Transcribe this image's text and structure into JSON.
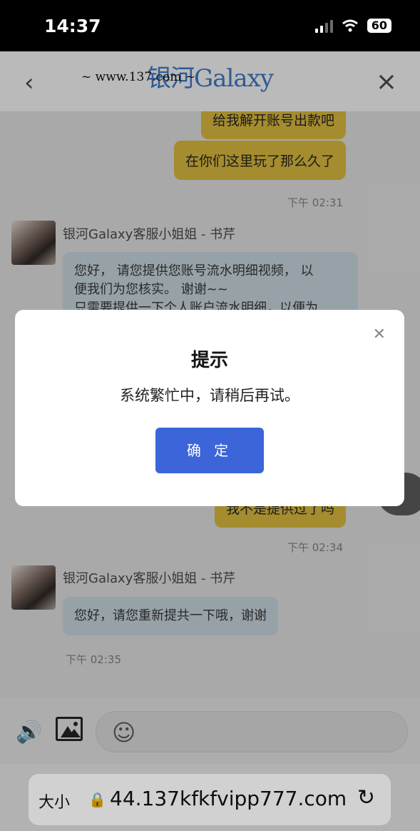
{
  "status_bar": {
    "time": "14:37",
    "battery": "60"
  },
  "header": {
    "logo_name": "银河Galaxy",
    "logo_url": "~ www.137.com ~",
    "back_icon": "chevron-left-icon",
    "close_icon": "close-icon"
  },
  "chat": {
    "messages": [
      {
        "text": "给我解开账号出款吧"
      },
      {
        "text": "在你们这里玩了那么久了"
      },
      {
        "time": "下午 02:31"
      },
      {
        "sender": "银河Galaxy客服小姐姐 - 书芹",
        "line1": "您好， 请您提供您账号流水明细视频， 以",
        "line2": "便我们为您核实。 谢谢~~",
        "line3": "只需要提供一下个人账户流水明细，以便为"
      },
      {
        "text": "我不是提供过了吗"
      },
      {
        "time": "下午 02:34"
      },
      {
        "sender": "银河Galaxy客服小姐姐 - 书芹",
        "text": "您好，请您重新提共一下哦，谢谢"
      },
      {
        "time": "下午 02:35"
      }
    ]
  },
  "input_bar": {
    "speaker_icon": "speaker-icon",
    "image_icon": "image-icon",
    "emoji_icon": "emoji-icon",
    "placeholder": ""
  },
  "url_bar": {
    "text_size": "大小",
    "url": "44.137kfkfvipp777.com"
  },
  "modal": {
    "title": "提示",
    "message": "系统繁忙中，请稍后再试。",
    "confirm": "确 定"
  }
}
